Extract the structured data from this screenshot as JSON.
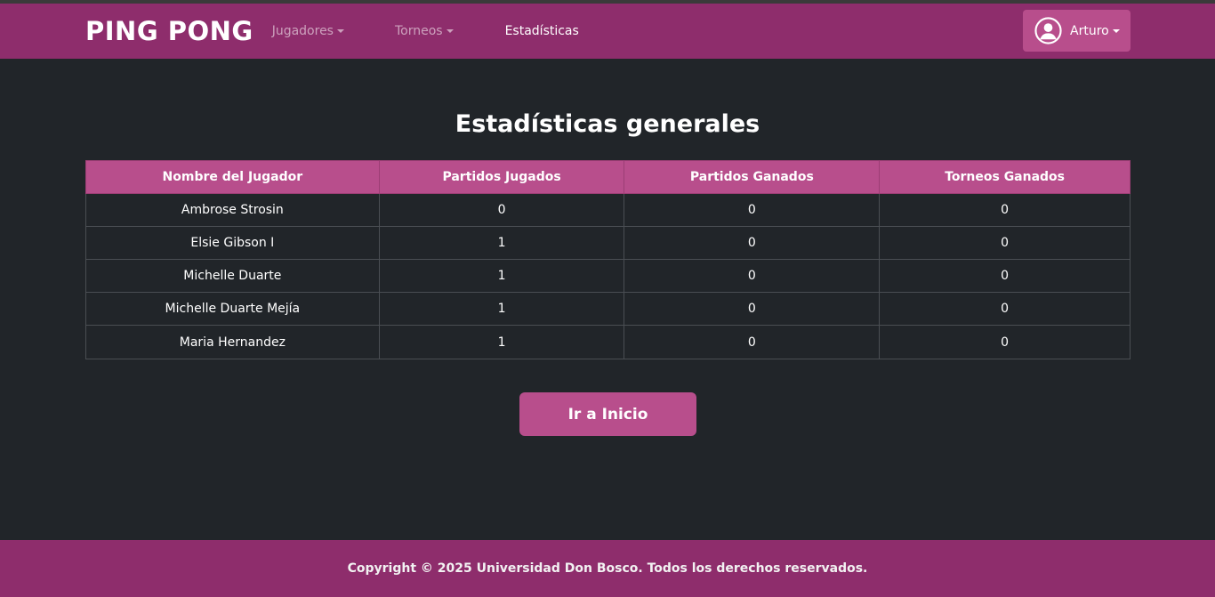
{
  "navbar": {
    "brand": "PING PONG",
    "items": [
      {
        "label": "Jugadores",
        "dropdown": true
      },
      {
        "label": "Torneos",
        "dropdown": true
      },
      {
        "label": "Estadísticas",
        "dropdown": false
      }
    ],
    "user": {
      "name": "Arturo",
      "icon": "user-circle-icon"
    }
  },
  "page": {
    "title": "Estadísticas generales",
    "home_button": "Ir a Inicio"
  },
  "table": {
    "headers": [
      "Nombre del Jugador",
      "Partidos Jugados",
      "Partidos Ganados",
      "Torneos Ganados"
    ],
    "rows": [
      [
        "Ambrose Strosin",
        "0",
        "0",
        "0"
      ],
      [
        "Elsie Gibson I",
        "1",
        "0",
        "0"
      ],
      [
        "Michelle Duarte",
        "1",
        "0",
        "0"
      ],
      [
        "Michelle Duarte Mejía",
        "1",
        "0",
        "0"
      ],
      [
        "Maria Hernandez",
        "1",
        "0",
        "0"
      ]
    ]
  },
  "footer": {
    "text": "Copyright © 2025 Universidad Don Bosco. Todos los derechos reservados."
  },
  "colors": {
    "navbar_bg": "#8e2d6c",
    "accent": "#b84e8c",
    "page_bg": "#212529"
  }
}
